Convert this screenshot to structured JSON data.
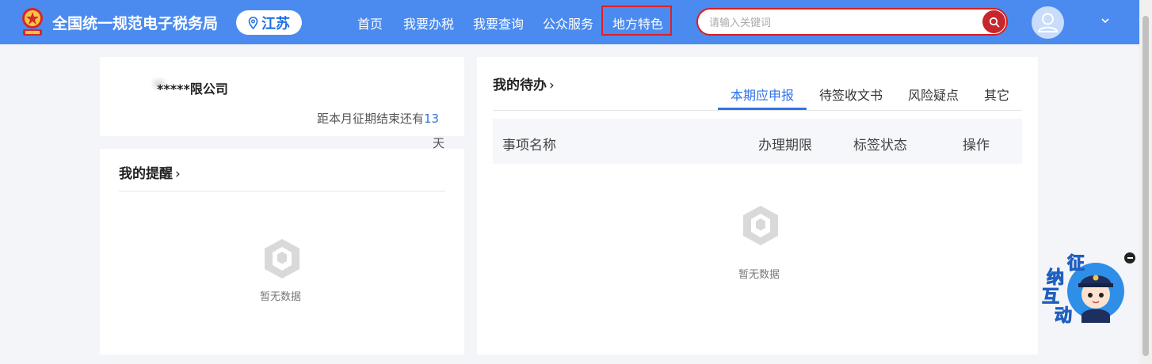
{
  "header": {
    "title": "全国统一规范电子税务局",
    "region": "江苏",
    "nav": [
      "首页",
      "我要办税",
      "我要查询",
      "公众服务",
      "地方特色"
    ],
    "search_placeholder": "请输入关键词",
    "colors": {
      "bar": "#4b8bef",
      "highlight": "#e02020",
      "search_button": "#c9252c"
    }
  },
  "company": {
    "name": "*****限公司",
    "deadline_text": "距本月征期结束还有",
    "deadline_days": "13",
    "deadline_unit": "天"
  },
  "reminders": {
    "title": "我的提醒",
    "empty_text": "暂无数据"
  },
  "todo": {
    "title": "我的待办",
    "tabs": [
      "本期应申报",
      "待签收文书",
      "风险疑点",
      "其它"
    ],
    "active_tab": 0,
    "columns": [
      "事项名称",
      "办理期限",
      "标签状态",
      "操作"
    ],
    "empty_text": "暂无数据"
  },
  "mascot": {
    "label": "征纳互动"
  }
}
